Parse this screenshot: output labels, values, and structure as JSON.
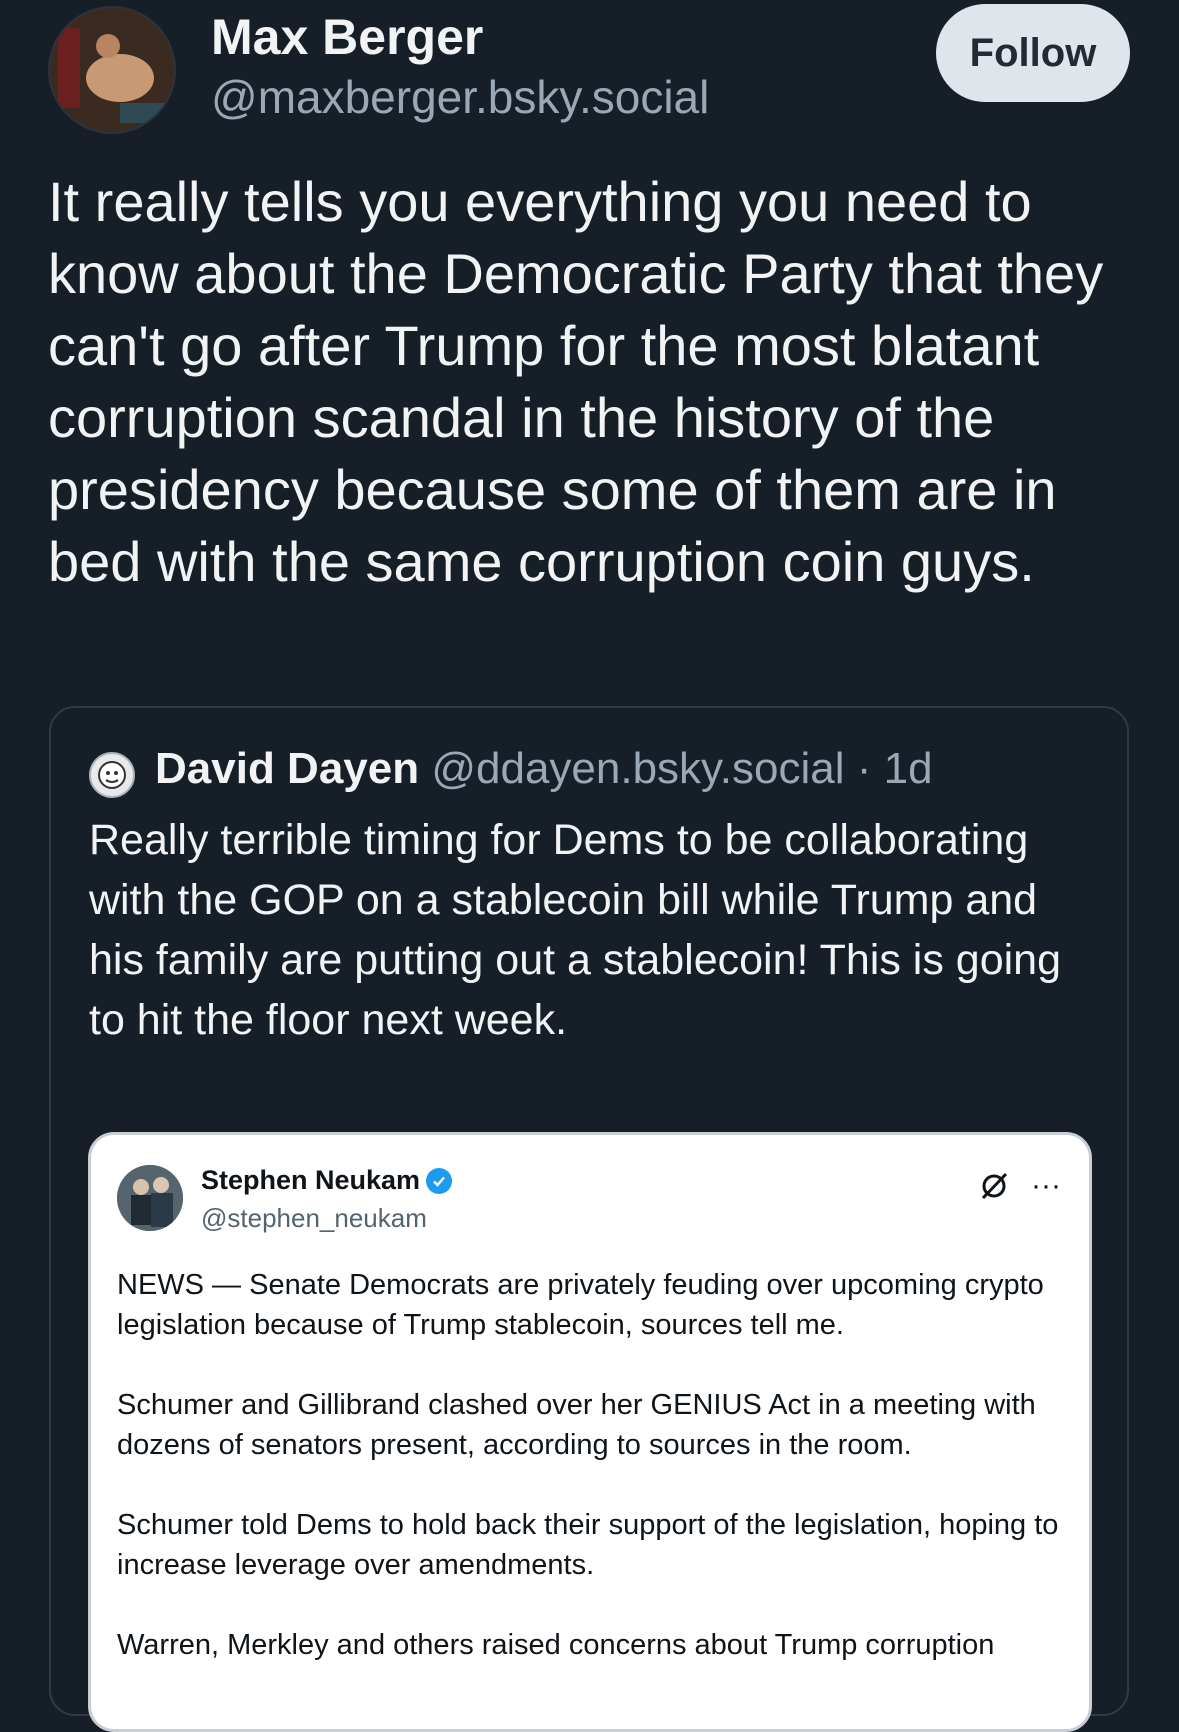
{
  "post": {
    "author_name": "Max Berger",
    "author_handle": "@maxberger.bsky.social",
    "follow_label": "Follow",
    "text": "It really tells you everything you need to know about the Democratic Party that they can't go after Trump for the most blatant corruption scandal in the history of the presidency because some of them are in bed with the same corruption coin guys."
  },
  "quote": {
    "author_name": "David Dayen",
    "author_handle": "@ddayen.bsky.social",
    "separator": " · ",
    "time": "1d",
    "text": "Really terrible timing for Dems to be collaborating with the GOP on a stablecoin bill while Trump and his family are putting out a stablecoin! This is going to hit the floor next week."
  },
  "embed": {
    "author_name": "Stephen Neukam",
    "author_handle": "@stephen_neukam",
    "icons": [
      "verified-badge-icon",
      "grok-slash-icon",
      "more-icon"
    ],
    "more_glyph": "···",
    "paragraphs": [
      "NEWS — Senate Democrats are privately feuding over upcoming crypto legislation because of Trump stablecoin, sources tell me.",
      "Schumer and Gillibrand clashed over her GENIUS Act in a meeting with dozens of senators present, according to sources in the room.",
      "Schumer told Dems to hold back their support of the legislation, hoping to increase leverage over amendments.",
      "Warren, Merkley and others raised concerns about Trump corruption"
    ]
  },
  "colors": {
    "background": "#161e27",
    "text": "#f1f3f5",
    "muted": "#9aa7b4",
    "follow_bg": "#dfe5eb",
    "verified": "#1d9bf0"
  }
}
